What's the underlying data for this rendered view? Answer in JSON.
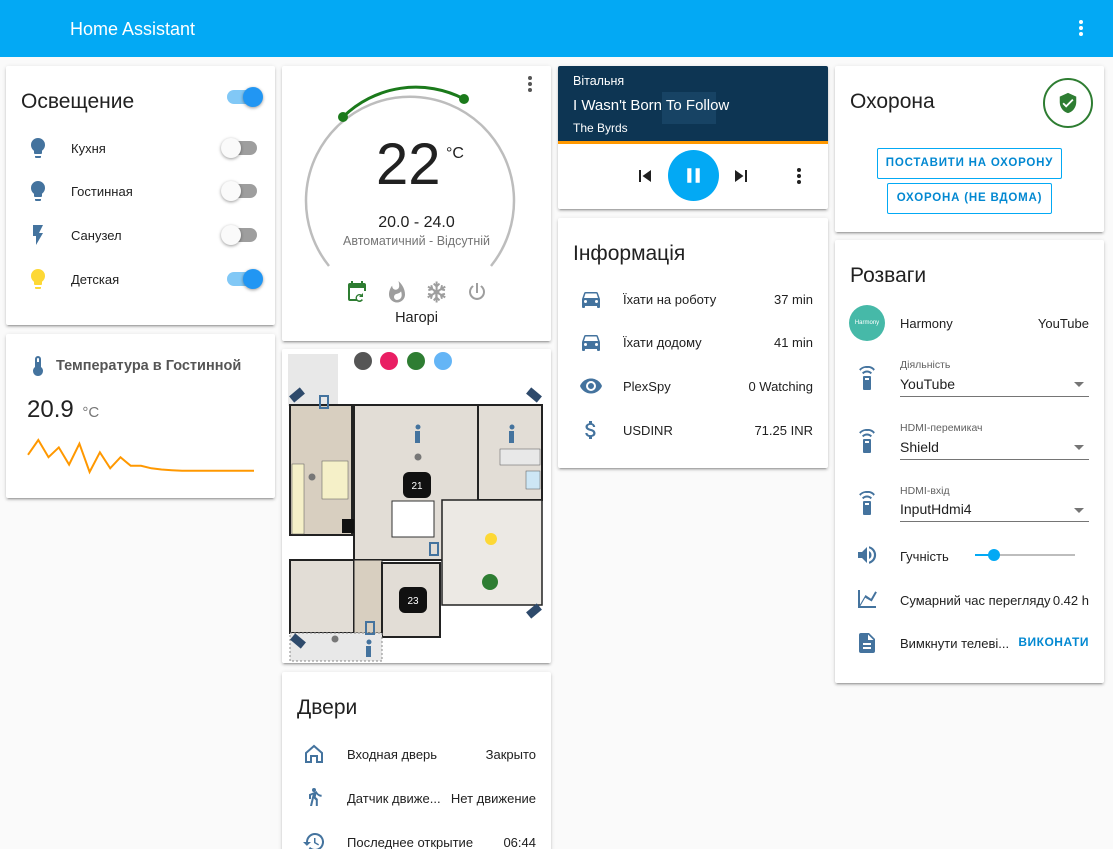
{
  "header": {
    "title": "Home Assistant"
  },
  "lights": {
    "title": "Освещение",
    "master_on": true,
    "items": [
      {
        "label": "Кухня",
        "icon": "bulb-icon",
        "on": false
      },
      {
        "label": "Гостинная",
        "icon": "bulb-icon",
        "on": false
      },
      {
        "label": "Санузел",
        "icon": "flash-icon",
        "on": false
      },
      {
        "label": "Детская",
        "icon": "bulb-icon",
        "on": true
      }
    ]
  },
  "temperature_sensor": {
    "title": "Температура в Гостинной",
    "value": "20.9",
    "unit": "°C",
    "history": [
      22.4,
      23.6,
      22.2,
      23.0,
      21.6,
      23.3,
      21.0,
      22.6,
      21.3,
      22.2,
      21.5,
      21.5,
      21.3,
      21.2,
      21.15,
      21.1,
      21.1,
      21.1,
      21.1,
      21.1,
      21.1,
      21.1,
      21.1
    ]
  },
  "thermostat": {
    "current": "22",
    "unit": "°C",
    "range": "20.0 - 24.0",
    "mode": "Автоматичний - Відсутній",
    "name": "Нагорі",
    "colors": {
      "arc": "#1b7a1b",
      "active": "#2e7d32"
    }
  },
  "media": {
    "room": "Вітальня",
    "title": "I Wasn't Born To Follow",
    "artist": "The Byrds",
    "progress": 0.0,
    "colors": {
      "bg": "#0d3553",
      "progress": "#ff9800",
      "play": "#03a9f4"
    }
  },
  "info": {
    "title": "Інформація",
    "items": [
      {
        "label": "Їхати на роботу",
        "value": "37 min",
        "icon": "car-icon"
      },
      {
        "label": "Їхати додому",
        "value": "41 min",
        "icon": "car-icon"
      },
      {
        "label": "PlexSpy",
        "value": "0 Watching",
        "icon": "eye-icon"
      },
      {
        "label": "USDINR",
        "value": "71.25 INR",
        "icon": "dollar-icon"
      }
    ]
  },
  "floorplan": {
    "thermostats": [
      "21",
      "23"
    ]
  },
  "doors": {
    "title": "Двери",
    "items": [
      {
        "label": "Входная дверь",
        "value": "Закрыто",
        "icon": "home-icon"
      },
      {
        "label": "Датчик движе...",
        "value": "Нет движение",
        "icon": "walk-icon"
      },
      {
        "label": "Последнее открытие",
        "value": "06:44",
        "icon": "history-icon"
      }
    ]
  },
  "security": {
    "title": "Охорона",
    "arm_home": "ПОСТАВИТИ НА ОХОРОНУ",
    "arm_away": "ОХОРОНА (НЕ ВДОМА)",
    "status_color": "#2e7d32"
  },
  "entertainment": {
    "title": "Розваги",
    "harmony": {
      "label": "Harmony",
      "value": "YouTube",
      "logo_text": "Harmony"
    },
    "activity": {
      "label": "Діяльність",
      "value": "YouTube"
    },
    "hdmi_switch": {
      "label": "HDMI-перемикач",
      "value": "Shield"
    },
    "hdmi_input": {
      "label": "HDMI-вхід",
      "value": "InputHdmi4"
    },
    "volume": {
      "label": "Гучність",
      "level": 0.19
    },
    "watch_time": {
      "label": "Сумарний час перегляду",
      "value": "0.42 h"
    },
    "tv_off": {
      "label": "Вимкнути телеві...",
      "action": "ВИКОНАТИ"
    }
  }
}
